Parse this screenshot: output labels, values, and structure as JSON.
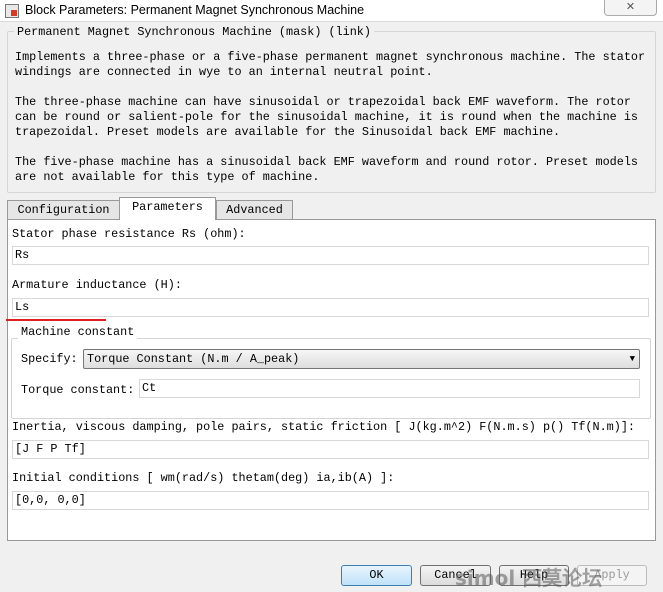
{
  "window": {
    "title": "Block Parameters: Permanent Magnet Synchronous Machine",
    "close_icon": "close-icon"
  },
  "description": {
    "legend": "Permanent Magnet Synchronous Machine (mask) (link)",
    "lines": [
      "Implements a three-phase or a five-phase permanent magnet synchronous machine. The stator",
      "windings are connected in wye to an internal neutral point.",
      "",
      "The three-phase machine can have sinusoidal or trapezoidal back EMF waveform. The rotor",
      "can be round or salient-pole for the sinusoidal machine, it is round when the machine is",
      "trapezoidal. Preset models are available for the Sinusoidal back EMF machine.",
      "",
      "The five-phase machine has a sinusoidal back EMF waveform and round rotor. Preset models",
      "are not available for this type of machine."
    ]
  },
  "tabs": [
    {
      "label": "Configuration",
      "active": false
    },
    {
      "label": "Parameters",
      "active": true
    },
    {
      "label": "Advanced",
      "active": false
    }
  ],
  "params": {
    "rs_label": "Stator phase resistance Rs (ohm):",
    "rs_value": "Rs",
    "ls_label": "Armature inductance (H):",
    "ls_value": "Ls",
    "machine_constant": {
      "legend": "Machine constant",
      "specify_label": "Specify:",
      "specify_value": "Torque Constant (N.m / A_peak)",
      "tc_label": "Torque constant:",
      "tc_value": "Ct"
    },
    "inertia_label": "Inertia, viscous damping, pole pairs, static friction [ J(kg.m^2)  F(N.m.s)  p()  Tf(N.m)]:",
    "inertia_value": "[J F P Tf]",
    "ic_label": "Initial conditions  [ wm(rad/s)  thetam(deg)  ia,ib(A) ]:",
    "ic_value": "[0,0, 0,0]"
  },
  "buttons": {
    "ok": "OK",
    "cancel": "Cancel",
    "help": "Help",
    "apply": "Apply"
  },
  "watermark": "simol 西莫论坛",
  "annotation_color": "#e02020"
}
